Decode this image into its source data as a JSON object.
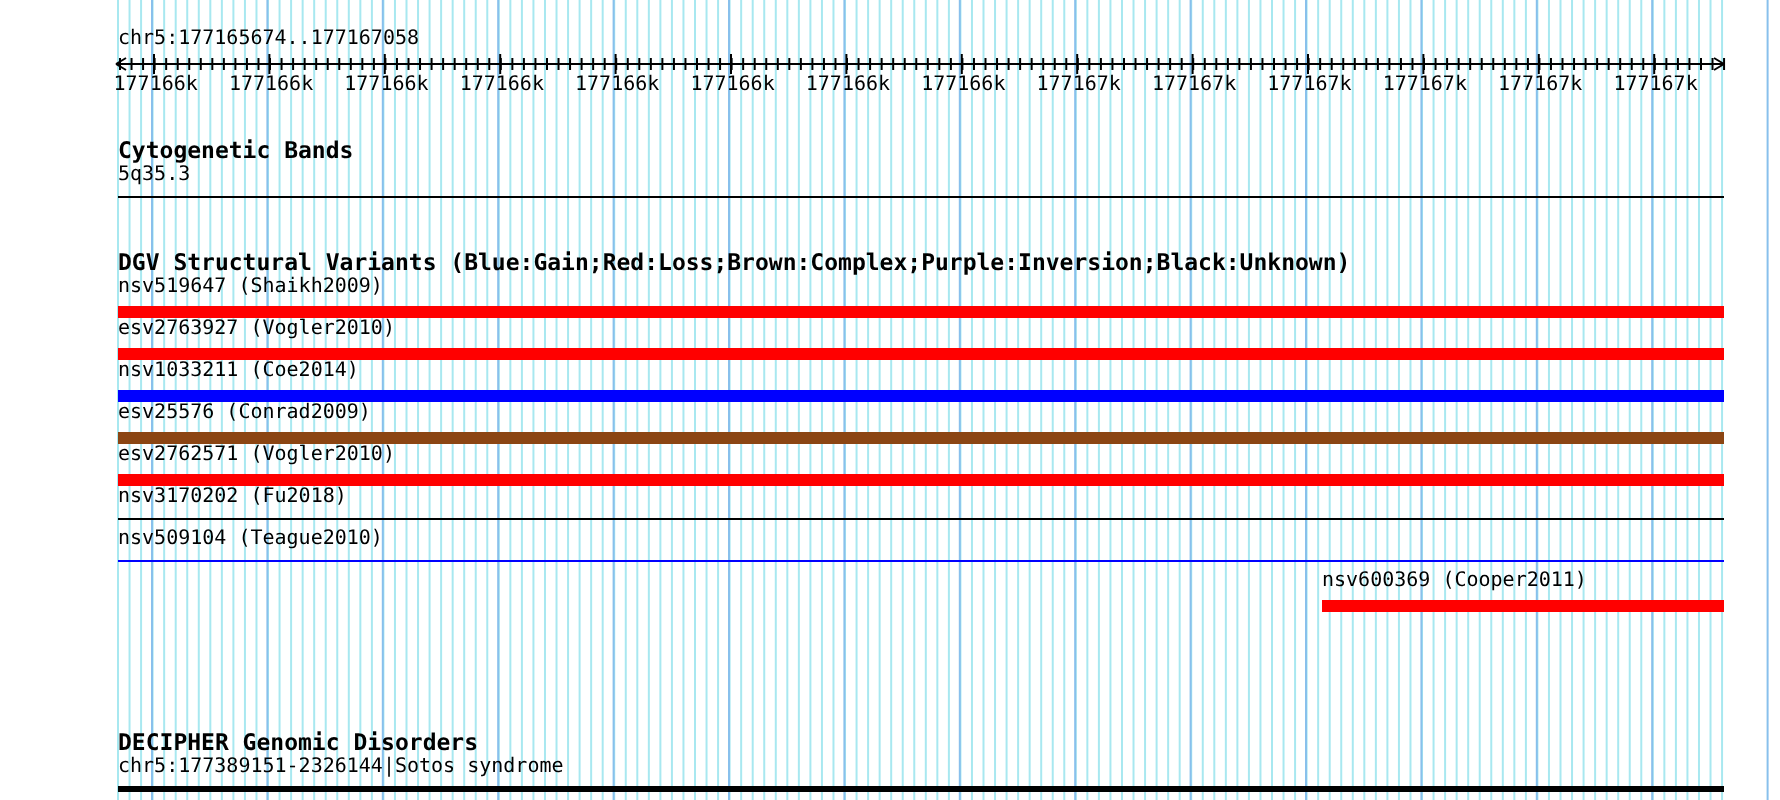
{
  "ruler": {
    "location": "chr5:177165674..177167058",
    "ticks": [
      "177166k",
      "177166k",
      "177166k",
      "177166k",
      "177166k",
      "177166k",
      "177166k",
      "177166k",
      "177167k",
      "177167k",
      "177167k",
      "177167k",
      "177167k",
      "177167k"
    ]
  },
  "tracks": [
    {
      "kind": "bands",
      "title": "Cytogenetic Bands",
      "features": [
        {
          "label": "5q35.3",
          "kind": "line",
          "color": "#000000",
          "partial": false
        }
      ]
    },
    {
      "kind": "variants",
      "title": "DGV Structural Variants (Blue:Gain;Red:Loss;Brown:Complex;Purple:Inversion;Black:Unknown)",
      "features": [
        {
          "label": "nsv519647 (Shaikh2009)",
          "kind": "bar",
          "color": "#ff0000",
          "partial": false
        },
        {
          "label": "esv2763927 (Vogler2010)",
          "kind": "bar",
          "color": "#ff0000",
          "partial": false
        },
        {
          "label": "nsv1033211 (Coe2014)",
          "kind": "bar",
          "color": "#0000ff",
          "partial": false
        },
        {
          "label": "esv25576 (Conrad2009)",
          "kind": "bar",
          "color": "#8b4513",
          "partial": false
        },
        {
          "label": "esv2762571 (Vogler2010)",
          "kind": "bar",
          "color": "#ff0000",
          "partial": false
        },
        {
          "label": "nsv3170202 (Fu2018)",
          "kind": "line",
          "color": "#000000",
          "partial": false
        },
        {
          "label": "nsv509104 (Teague2010)",
          "kind": "line",
          "color": "#0000ff",
          "partial": false
        },
        {
          "label": "nsv600369 (Cooper2011)",
          "kind": "bar",
          "color": "#ff0000",
          "partial": true
        }
      ]
    },
    {
      "kind": "disorders",
      "title": "DECIPHER Genomic Disorders",
      "features": [
        {
          "label": "chr5:177389151-2326144|Sotos syndrome",
          "kind": "thick",
          "color": "#000000",
          "partial": false
        }
      ]
    }
  ]
}
